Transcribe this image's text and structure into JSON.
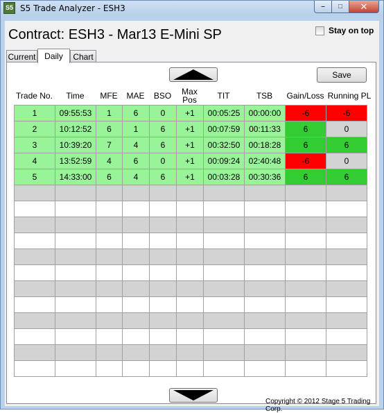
{
  "window": {
    "icon_text": "S5",
    "title": "S5 Trade Analyzer - ESH3",
    "minimize_glyph": "–",
    "maximize_glyph": "□",
    "close_glyph": "✕"
  },
  "header": {
    "contract_title": "Contract: ESH3 - Mar13 E-Mini SP",
    "stay_on_top_label": "Stay on top",
    "stay_on_top_checked": false
  },
  "tabs": [
    {
      "label": "Current",
      "active": false
    },
    {
      "label": "Daily",
      "active": true
    },
    {
      "label": "Chart",
      "active": false
    }
  ],
  "toolbar": {
    "scroll_up_icon": "triangle-up-icon",
    "scroll_down_icon": "triangle-down-icon",
    "save_label": "Save"
  },
  "table": {
    "columns": [
      "Trade No.",
      "Time",
      "MFE",
      "MAE",
      "BSO",
      "Max Pos",
      "TIT",
      "TSB",
      "Gain/Loss",
      "Running PL"
    ],
    "rows": [
      [
        "1",
        "09:55:53",
        "1",
        "6",
        "0",
        "+1",
        "00:05:25",
        "00:00:00",
        "-6",
        "-6"
      ],
      [
        "2",
        "10:12:52",
        "6",
        "1",
        "6",
        "+1",
        "00:07:59",
        "00:11:33",
        "6",
        "0"
      ],
      [
        "3",
        "10:39:20",
        "7",
        "4",
        "6",
        "+1",
        "00:32:50",
        "00:18:28",
        "6",
        "6"
      ],
      [
        "4",
        "13:52:59",
        "4",
        "6",
        "0",
        "+1",
        "00:09:24",
        "02:40:48",
        "-6",
        "0"
      ],
      [
        "5",
        "14:33:00",
        "6",
        "4",
        "6",
        "+1",
        "00:03:28",
        "00:30:36",
        "6",
        "6"
      ]
    ],
    "empty_rows": 12,
    "colors": {
      "trade_row": "#99f399",
      "empty_row_odd": "#d3d3d3",
      "empty_row_even": "#ffffff",
      "loss": "#ff0000",
      "gain": "#33cc33",
      "neutral": "#d3d3d3"
    }
  },
  "footer": {
    "copyright": "Copyright © 2012 Stage 5 Trading Corp."
  }
}
